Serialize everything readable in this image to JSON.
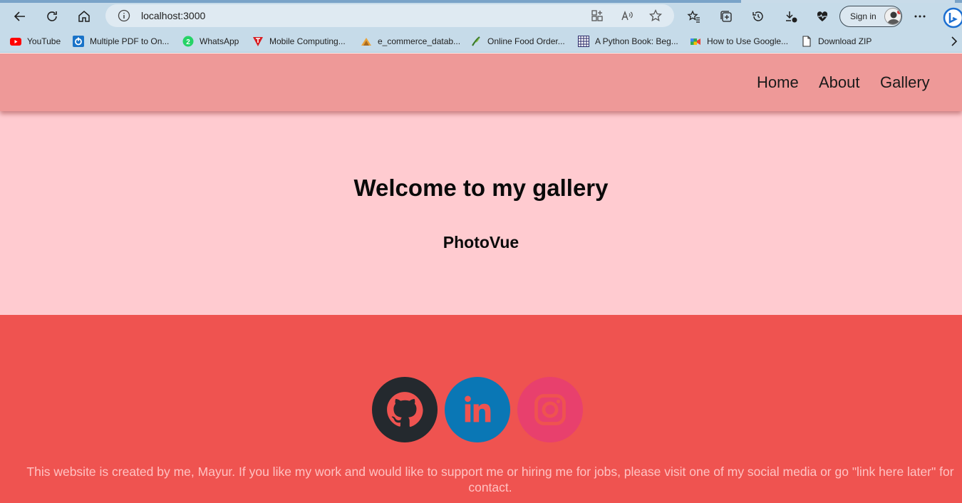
{
  "browser": {
    "url": "localhost:3000",
    "sign_in_label": "Sign in",
    "bookmarks": [
      {
        "label": "YouTube",
        "icon": "youtube-icon"
      },
      {
        "label": "Multiple PDF to On...",
        "icon": "pdf-tool-icon"
      },
      {
        "label": "WhatsApp",
        "icon": "whatsapp-icon"
      },
      {
        "label": "Mobile Computing...",
        "icon": "mobile-computing-icon"
      },
      {
        "label": "e_commerce_datab...",
        "icon": "database-icon"
      },
      {
        "label": "Online Food Order...",
        "icon": "food-icon"
      },
      {
        "label": "A Python Book: Beg...",
        "icon": "grid-icon"
      },
      {
        "label": "How to Use Google...",
        "icon": "google-meet-icon"
      },
      {
        "label": "Download ZIP",
        "icon": "file-icon"
      }
    ]
  },
  "nav": {
    "links": [
      "Home",
      "About",
      "Gallery"
    ]
  },
  "hero": {
    "title": "Welcome to my gallery",
    "subtitle": "PhotoVue"
  },
  "footer": {
    "social": [
      {
        "name": "GitHub",
        "icon": "github-icon",
        "color": "#24292e"
      },
      {
        "name": "LinkedIn",
        "icon": "linkedin-icon",
        "color": "#0a77b5"
      },
      {
        "name": "Instagram",
        "icon": "instagram-icon",
        "color": "#e8406d"
      }
    ],
    "text": "This website is created by me, Mayur. If you like my work and would like to support me or hiring me for jobs, please visit one of my social media or go \"link here later\" for contact."
  },
  "colors": {
    "navbar": "#ee9998",
    "hero_bg": "#ffcbd0",
    "footer_bg": "#ef5350",
    "footer_text": "#ffc2c2"
  }
}
